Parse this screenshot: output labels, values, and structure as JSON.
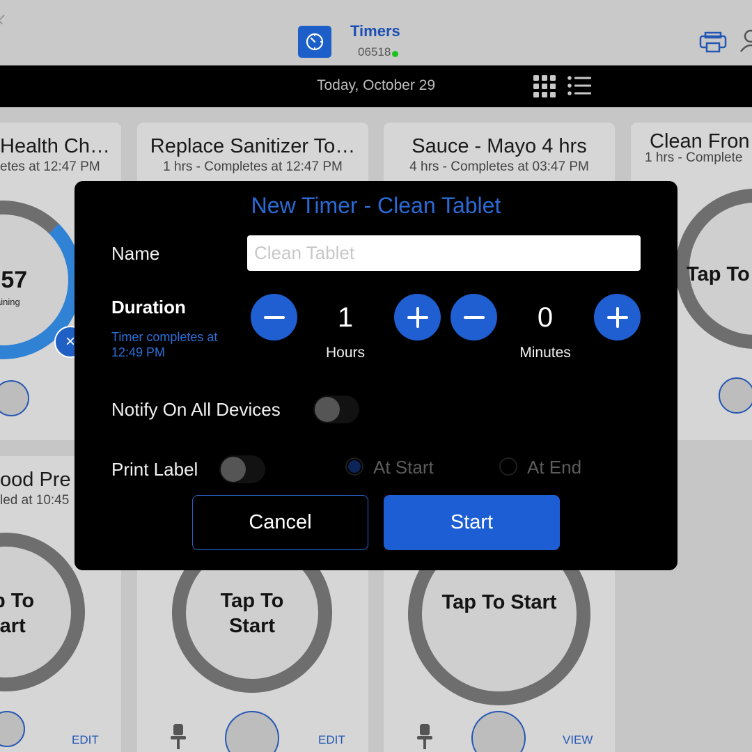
{
  "header": {
    "app_title": "Timers",
    "store_number": "06518",
    "status_color": "#1bc41b",
    "app_icon": "timer-icon"
  },
  "datebar": {
    "date": "Today, October 29",
    "view_icons": [
      "grid-view-icon",
      "list-view-icon"
    ]
  },
  "cards": {
    "health_check": {
      "title": "Health Ch…",
      "subtitle": "etes at 12:47 PM",
      "time": ":57",
      "remaining": "aining"
    },
    "replace_sanitizer": {
      "title": "Replace Sanitizer To…",
      "subtitle": "1 hrs - Completes at 12:47 PM"
    },
    "sauce_mayo": {
      "title": "Sauce - Mayo 4 hrs",
      "subtitle": "4 hrs - Completes at 03:47 PM"
    },
    "clean_front": {
      "title": "Clean Fron",
      "subtitle": "1 hrs - Complete",
      "ring_label": "Tap To"
    },
    "food_prep": {
      "title": "ood Pre",
      "subtitle": "led at 10:45",
      "ring_label_1": "p To",
      "ring_label_2": "tart",
      "action": "EDIT"
    },
    "bottom_middle": {
      "ring_label_1": "Tap To",
      "ring_label_2": "Start",
      "action": "EDIT"
    },
    "bottom_right": {
      "ring_label": "Tap To Start",
      "action": "VIEW"
    }
  },
  "modal": {
    "title": "New Timer - Clean Tablet",
    "name_label": "Name",
    "name_placeholder": "Clean Tablet",
    "duration_label": "Duration",
    "completes_note": "Timer completes at 12:49 PM",
    "hours": "1",
    "hours_unit": "Hours",
    "minutes": "0",
    "minutes_unit": "Minutes",
    "notify_label": "Notify On All Devices",
    "notify_on": false,
    "print_label": "Print Label",
    "print_on": false,
    "at_start_label": "At Start",
    "at_end_label": "At End",
    "selected_print_option": "At Start",
    "cancel_label": "Cancel",
    "start_label": "Start",
    "accent_color": "#1d5ed4"
  }
}
